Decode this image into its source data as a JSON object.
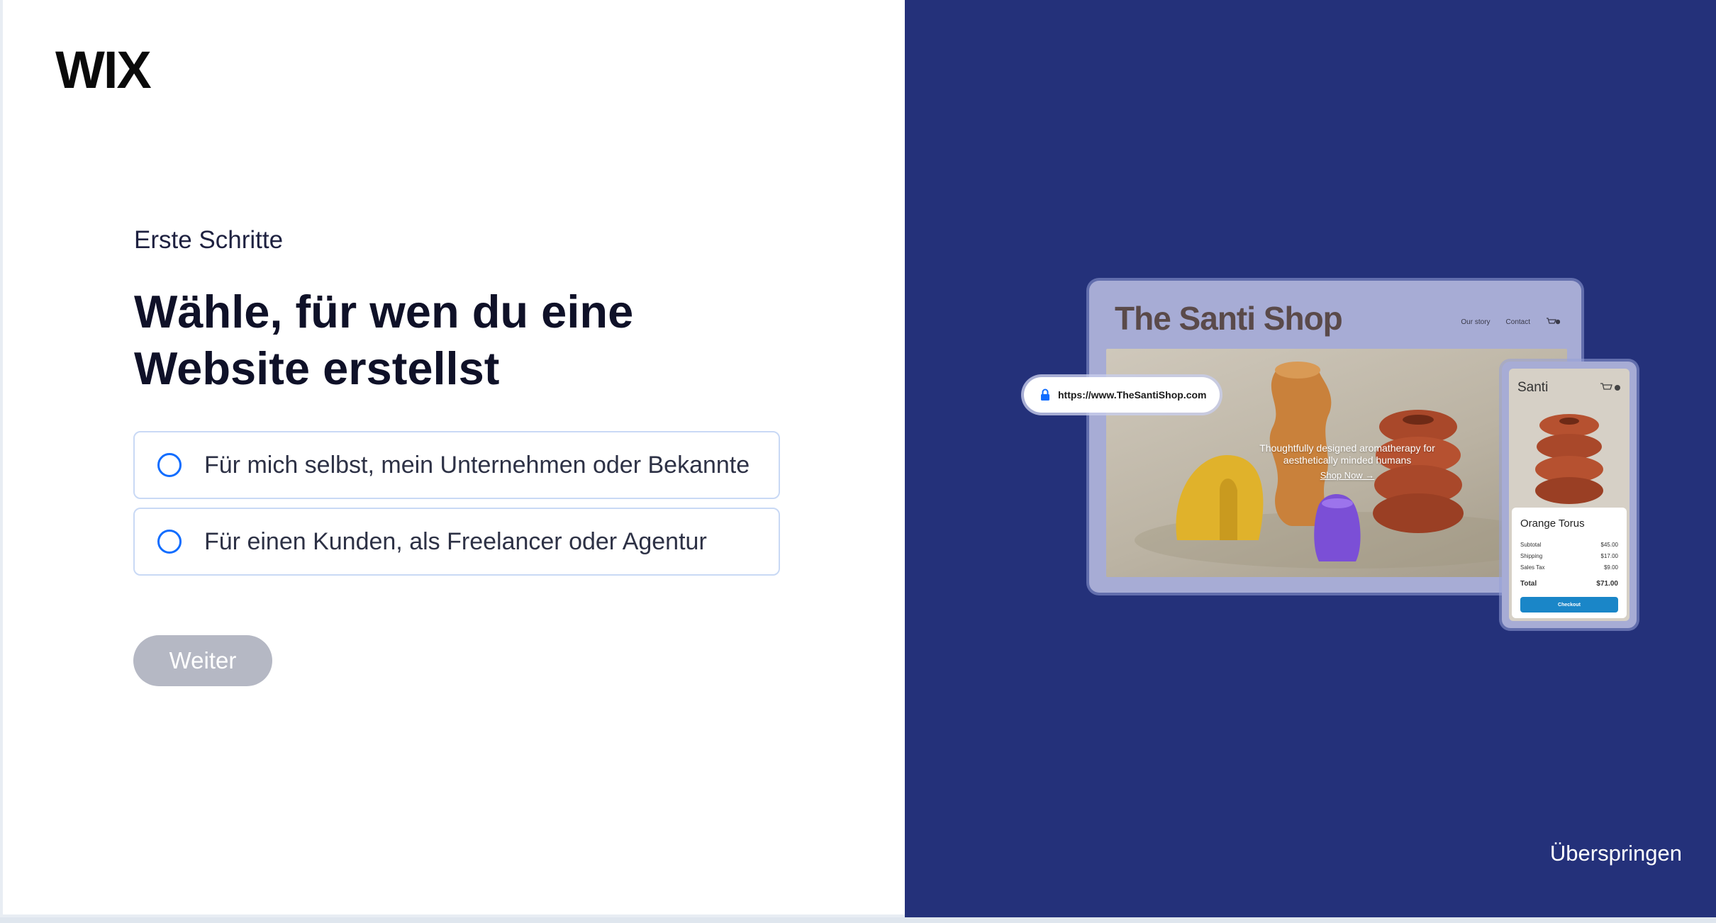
{
  "logo": {
    "text": "WIX"
  },
  "onboarding": {
    "step_label": "Erste Schritte",
    "headline": "Wähle, für wen du eine Website erstellst",
    "options": [
      {
        "label": "Für mich selbst, mein Unternehmen oder Bekannte",
        "selected": false
      },
      {
        "label": "Für einen Kunden, als Freelancer oder Agentur",
        "selected": false
      }
    ],
    "next_button": "Weiter",
    "skip_link": "Überspringen"
  },
  "mockup": {
    "shop_title": "The Santi Shop",
    "nav": [
      "Our story",
      "Contact"
    ],
    "hero_text": "Thoughtfully designed aromatherapy for aesthetically minded humans",
    "shop_now": "Shop Now →",
    "url": "https://www.TheSantiShop.com",
    "phone": {
      "brand": "Santi",
      "product": "Orange Torus",
      "rows": [
        {
          "label": "Subtotal",
          "value": "$45.00"
        },
        {
          "label": "Shipping",
          "value": "$17.00"
        },
        {
          "label": "Sales Tax",
          "value": "$9.00"
        }
      ],
      "total_label": "Total",
      "total_value": "$71.00",
      "checkout": "Checkout"
    }
  },
  "colors": {
    "accent": "#116dff",
    "right_panel": "#24317a",
    "button_disabled": "#b5b8c4"
  }
}
